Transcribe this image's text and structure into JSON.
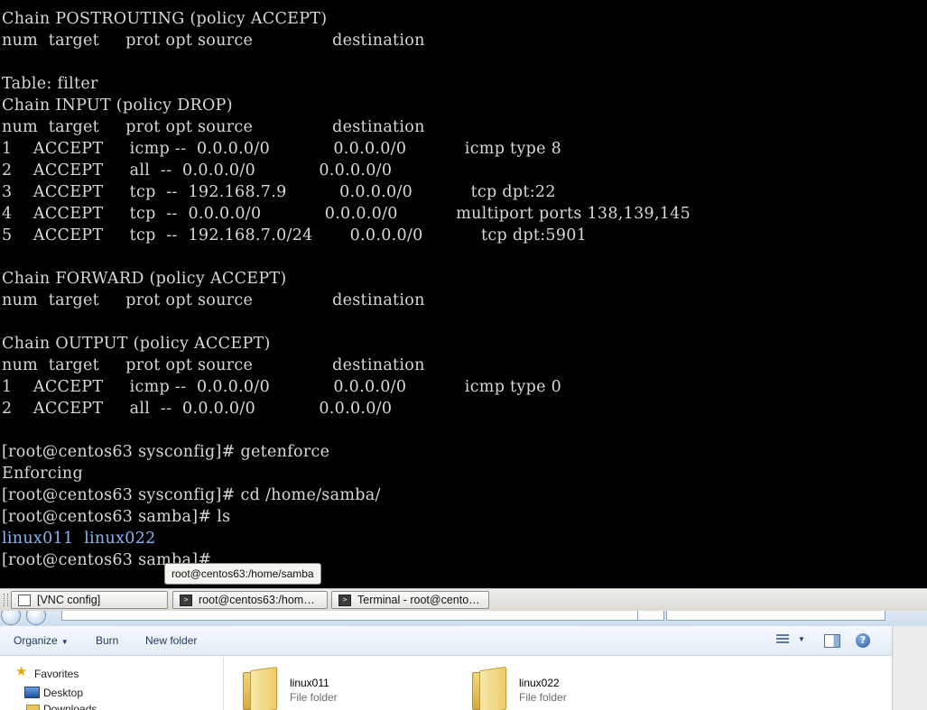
{
  "terminal": {
    "lines": [
      "Chain POSTROUTING (policy ACCEPT)",
      "num  target     prot opt source               destination",
      "",
      "Table: filter",
      "Chain INPUT (policy DROP)",
      "num  target     prot opt source               destination",
      "1    ACCEPT     icmp --  0.0.0.0/0            0.0.0.0/0           icmp type 8",
      "2    ACCEPT     all  --  0.0.0.0/0            0.0.0.0/0",
      "3    ACCEPT     tcp  --  192.168.7.9          0.0.0.0/0           tcp dpt:22",
      "4    ACCEPT     tcp  --  0.0.0.0/0            0.0.0.0/0           multiport ports 138,139,145",
      "5    ACCEPT     tcp  --  192.168.7.0/24       0.0.0.0/0           tcp dpt:5901",
      "",
      "Chain FORWARD (policy ACCEPT)",
      "num  target     prot opt source               destination",
      "",
      "Chain OUTPUT (policy ACCEPT)",
      "num  target     prot opt source               destination",
      "1    ACCEPT     icmp --  0.0.0.0/0            0.0.0.0/0           icmp type 0",
      "2    ACCEPT     all  --  0.0.0.0/0            0.0.0.0/0",
      "",
      "[root@centos63 sysconfig]# getenforce",
      "Enforcing",
      "[root@centos63 sysconfig]# cd /home/samba/",
      "[root@centos63 samba]# ls",
      "linux011  linux022",
      "[root@centos63 samba]# "
    ],
    "text_color": "#d8d8d8",
    "dir_color": "#8ab4f0",
    "tooltip": "root@centos63:/home/samba"
  },
  "taskbar": {
    "tasks": [
      {
        "label": "[VNC config]",
        "icon": "window-icon"
      },
      {
        "label": "root@centos63:/hom…",
        "icon": "terminal-icon"
      },
      {
        "label": "Terminal - root@cento…",
        "icon": "terminal-icon"
      }
    ]
  },
  "explorer": {
    "toolbar": {
      "organize": "Organize",
      "burn": "Burn",
      "new_folder": "New folder"
    },
    "nav": {
      "favorites": "Favorites",
      "desktop": "Desktop",
      "downloads_partial": "Downloads"
    },
    "items": [
      {
        "name": "linux011",
        "type": "File folder"
      },
      {
        "name": "linux022",
        "type": "File folder"
      }
    ],
    "help_glyph": "?"
  }
}
